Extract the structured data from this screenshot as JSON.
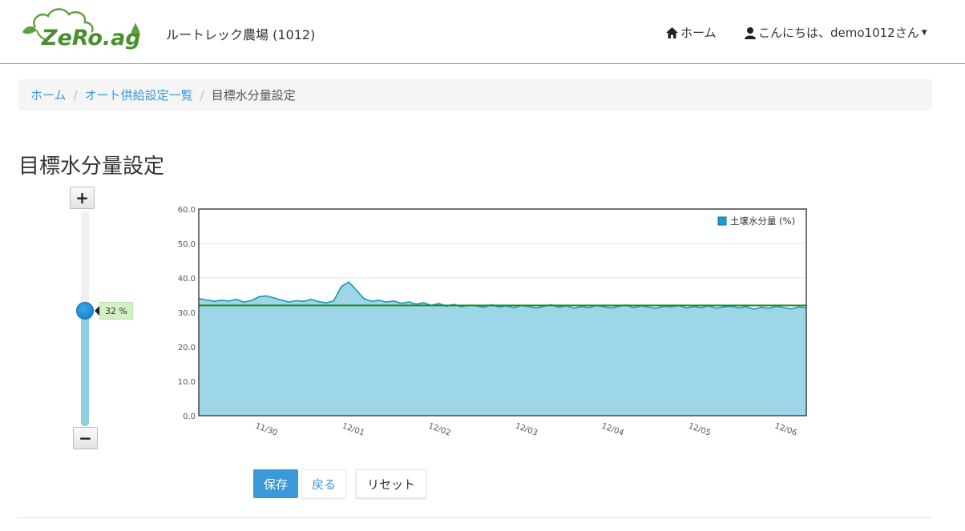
{
  "header": {
    "logo_text": "ZeRo.agri",
    "farm_name": "ルートレック農場 (1012)",
    "nav_home_label": "ホーム",
    "nav_user_label": "こんにちは、demo1012さん"
  },
  "breadcrumb": {
    "items": [
      "ホーム",
      "オート供給設定一覧"
    ],
    "active": "目標水分量設定",
    "separator": "/"
  },
  "page": {
    "title": "目標水分量設定"
  },
  "slider": {
    "plus_label": "+",
    "minus_label": "−",
    "value": 32,
    "value_label": "32 %",
    "min": 0,
    "max": 60
  },
  "colors": {
    "accent": "#3a9ad9",
    "series_line": "#1997b5",
    "series_fill": "#9dd6e6",
    "target_line": "#1e8a1e",
    "tip_bg": "#d3f0c4"
  },
  "chart_data": {
    "type": "area",
    "ylim": [
      0,
      60
    ],
    "yticks": [
      "60.0",
      "50.0",
      "40.0",
      "30.0",
      "20.0",
      "10.0",
      "0.0"
    ],
    "xticks": [
      "11/30",
      "12/01",
      "12/02",
      "12/03",
      "12/04",
      "12/05",
      "12/06"
    ],
    "legend": "土壌水分量 (%)",
    "legend_position": "top-right",
    "target_value": 32,
    "series": [
      {
        "name": "土壌水分量 (%)",
        "x": [
          "11/29 12:00",
          "11/29 14:00",
          "11/29 16:00",
          "11/29 18:00",
          "11/29 20:00",
          "11/29 22:00",
          "11/30 00:00",
          "11/30 02:00",
          "11/30 04:00",
          "11/30 06:00",
          "11/30 08:00",
          "11/30 10:00",
          "11/30 12:00",
          "11/30 14:00",
          "11/30 16:00",
          "11/30 18:00",
          "11/30 20:00",
          "11/30 22:00",
          "12/01 00:00",
          "12/01 02:00",
          "12/01 04:00",
          "12/01 06:00",
          "12/01 08:00",
          "12/01 10:00",
          "12/01 12:00",
          "12/01 14:00",
          "12/01 16:00",
          "12/01 18:00",
          "12/01 20:00",
          "12/01 22:00",
          "12/02 00:00",
          "12/02 02:00",
          "12/02 04:00",
          "12/02 06:00",
          "12/02 08:00",
          "12/02 10:00",
          "12/02 12:00",
          "12/02 14:00",
          "12/02 16:00",
          "12/02 18:00",
          "12/02 20:00",
          "12/02 22:00",
          "12/03 00:00",
          "12/03 02:00",
          "12/03 04:00",
          "12/03 06:00",
          "12/03 08:00",
          "12/03 10:00",
          "12/03 12:00",
          "12/03 14:00",
          "12/03 16:00",
          "12/03 18:00",
          "12/03 20:00",
          "12/03 22:00",
          "12/04 00:00",
          "12/04 02:00",
          "12/04 04:00",
          "12/04 06:00",
          "12/04 08:00",
          "12/04 10:00",
          "12/04 12:00",
          "12/04 14:00",
          "12/04 16:00",
          "12/04 18:00",
          "12/04 20:00",
          "12/04 22:00",
          "12/05 00:00",
          "12/05 02:00",
          "12/05 04:00",
          "12/05 06:00",
          "12/05 08:00",
          "12/05 10:00",
          "12/05 12:00",
          "12/05 14:00",
          "12/05 16:00",
          "12/05 18:00",
          "12/05 20:00",
          "12/05 22:00",
          "12/06 00:00",
          "12/06 02:00",
          "12/06 04:00",
          "12/06 06:00"
        ],
        "values": [
          34.0,
          33.6,
          33.2,
          33.5,
          33.3,
          33.8,
          33.0,
          33.4,
          34.5,
          34.8,
          34.2,
          33.6,
          33.0,
          33.4,
          33.2,
          33.8,
          33.1,
          32.8,
          33.3,
          37.5,
          38.8,
          36.5,
          34.0,
          33.2,
          33.5,
          33.0,
          33.3,
          32.6,
          33.0,
          32.4,
          32.8,
          32.0,
          32.6,
          31.8,
          32.3,
          31.6,
          32.1,
          31.9,
          31.5,
          32.2,
          31.6,
          31.9,
          31.4,
          32.0,
          31.7,
          31.3,
          31.8,
          32.2,
          31.5,
          31.9,
          31.2,
          31.7,
          31.4,
          32.0,
          31.6,
          31.3,
          31.8,
          32.1,
          31.4,
          31.9,
          31.5,
          31.2,
          31.8,
          31.6,
          32.0,
          31.3,
          31.7,
          31.4,
          31.9,
          31.2,
          31.6,
          31.8,
          31.3,
          31.7,
          30.9,
          31.5,
          31.2,
          31.8,
          31.4,
          31.0,
          31.6,
          31.3
        ]
      }
    ]
  },
  "actions": {
    "save_label": "保存",
    "back_label": "戻る",
    "reset_label": "リセット"
  }
}
